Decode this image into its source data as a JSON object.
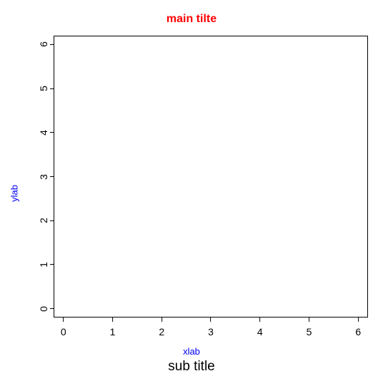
{
  "chart_data": {
    "type": "scatter",
    "title": "main tilte",
    "subtitle": "sub title",
    "xlabel": "xlab",
    "ylabel": "ylab",
    "xlim": [
      -0.2,
      6.2
    ],
    "ylim": [
      -0.2,
      6.2
    ],
    "x_ticks": [
      0,
      1,
      2,
      3,
      4,
      5,
      6
    ],
    "y_ticks": [
      0,
      1,
      2,
      3,
      4,
      5,
      6
    ],
    "x_tick_labels": [
      "0",
      "1",
      "2",
      "3",
      "4",
      "5",
      "6"
    ],
    "y_tick_labels": [
      "0",
      "1",
      "2",
      "3",
      "4",
      "5",
      "6"
    ],
    "series": []
  },
  "colors": {
    "title": "#ff0000",
    "axis_label": "#0000ff",
    "subtitle": "#000000"
  }
}
